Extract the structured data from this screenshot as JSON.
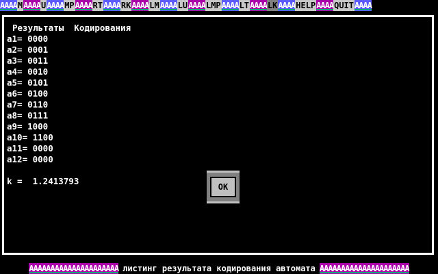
{
  "menubar": {
    "pad_text": "AAAA",
    "items": [
      "M",
      "U",
      "MP",
      "RT",
      "RK",
      "LM",
      "LU",
      "LMP",
      "LT",
      "LK",
      "HELP",
      "QUIT"
    ],
    "active_item": "LK"
  },
  "listing": {
    "header": "Результаты  Кодирования",
    "rows": [
      "a1= 0000",
      "a2= 0001",
      "a3= 0011",
      "a4= 0010",
      "a5= 0101",
      "a6= 0100",
      "a7= 0110",
      "a8= 0111",
      "a9= 1000",
      "a10= 1100",
      "a11= 0000",
      "a12= 0000"
    ],
    "coefficient": "k =  1.2413793"
  },
  "dialog": {
    "ok_label": "OK"
  },
  "statusbar": {
    "left_pad": "AAAAAAAAAAAAAAAAAAAAA",
    "text": "листинг результата кодирования автомата",
    "right_pad": "AAAAAAAAAAAAAAAAAAAAA"
  },
  "colors": {
    "pad_blue": "#5a5aff",
    "pad_magenta": "#aa00aa",
    "menu_item_bg": "#c8c8c8",
    "menu_active_bg": "#808080",
    "window_border": "#ffffff"
  }
}
